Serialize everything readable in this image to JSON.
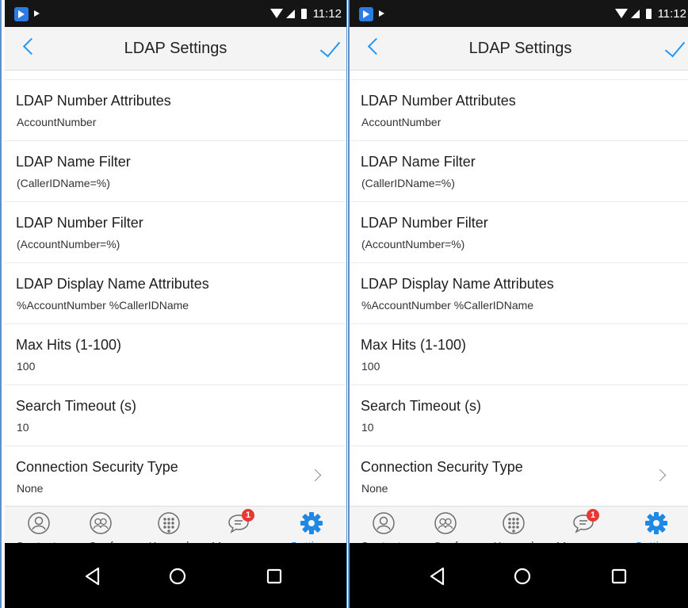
{
  "status_bar": {
    "time": "11:12"
  },
  "header": {
    "title": "LDAP Settings"
  },
  "settings": [
    {
      "title": "LDAP Number Attributes",
      "value": "AccountNumber",
      "has_chevron": false
    },
    {
      "title": "LDAP Name Filter",
      "value": "(CallerIDName=%)",
      "has_chevron": false
    },
    {
      "title": "LDAP Number Filter",
      "value": "(AccountNumber=%)",
      "has_chevron": false
    },
    {
      "title": "LDAP Display Name Attributes",
      "value": "%AccountNumber %CallerIDName",
      "has_chevron": false
    },
    {
      "title": "Max Hits (1-100)",
      "value": "100",
      "has_chevron": false
    },
    {
      "title": "Search Timeout (s)",
      "value": "10",
      "has_chevron": false
    },
    {
      "title": "Connection Security Type",
      "value": "None",
      "has_chevron": true
    }
  ],
  "tabs": [
    {
      "label": "Contacts",
      "icon": "contacts-icon",
      "active": false
    },
    {
      "label": "Conf",
      "icon": "conference-icon",
      "active": false
    },
    {
      "label": "Keypad",
      "icon": "keypad-icon",
      "active": false
    },
    {
      "label": "Messages",
      "icon": "messages-icon",
      "active": false,
      "badge": "1"
    },
    {
      "label": "Settings",
      "icon": "settings-gear-icon",
      "active": true
    }
  ],
  "nav_bar": {
    "buttons": [
      "back-triangle-icon",
      "home-circle-icon",
      "recents-square-icon"
    ]
  },
  "colors": {
    "accent": "#2196f3",
    "active_tab": "#1e88e5",
    "badge": "#e53935",
    "status_bar": "#151515",
    "nav_bar": "#000000"
  }
}
